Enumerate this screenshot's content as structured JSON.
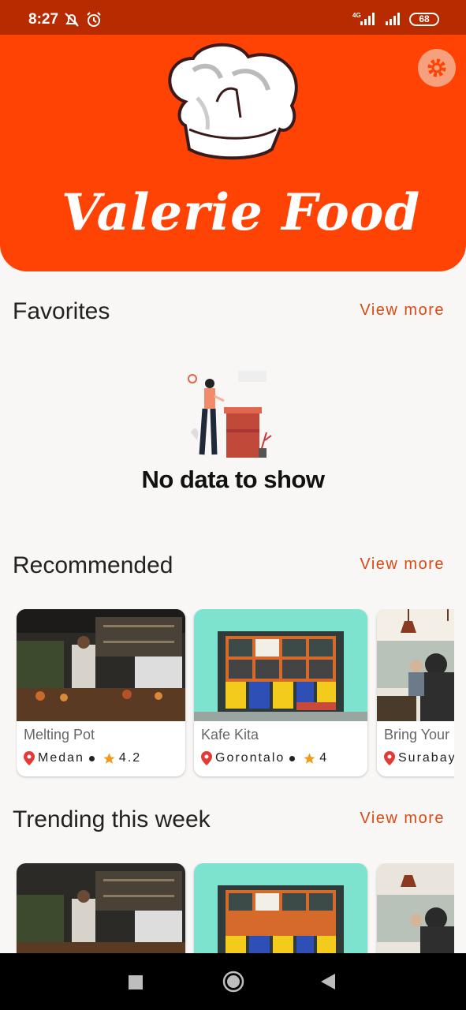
{
  "status_bar": {
    "time": "8:27",
    "network": "4G",
    "battery": "68",
    "icons": [
      "bell-off-icon",
      "alarm-icon",
      "signal-icon",
      "signal-icon",
      "battery-icon"
    ]
  },
  "header": {
    "brand_title": "Valerie Food",
    "logo_icon": "chef-hat-icon",
    "settings_icon": "gear-icon",
    "background_color": "#fe4305"
  },
  "favorites": {
    "title": "Favorites",
    "view_more": "View more",
    "empty_text": "No data to show"
  },
  "recommended": {
    "title": "Recommended",
    "view_more": "View more",
    "items": [
      {
        "name": "Melting Pot",
        "city": "Medan",
        "rating": "4.2"
      },
      {
        "name": "Kafe Kita",
        "city": "Gorontalo",
        "rating": "4"
      },
      {
        "name": "Bring Your",
        "city": "Surabay",
        "rating": ""
      }
    ]
  },
  "trending": {
    "title": "Trending this week",
    "view_more": "View more"
  },
  "nav": {
    "icons": [
      "recents-square-icon",
      "home-circle-icon",
      "back-triangle-icon"
    ]
  },
  "colors": {
    "accent": "#d94a12",
    "status_bar": "#b82a00",
    "header": "#fe4305"
  }
}
